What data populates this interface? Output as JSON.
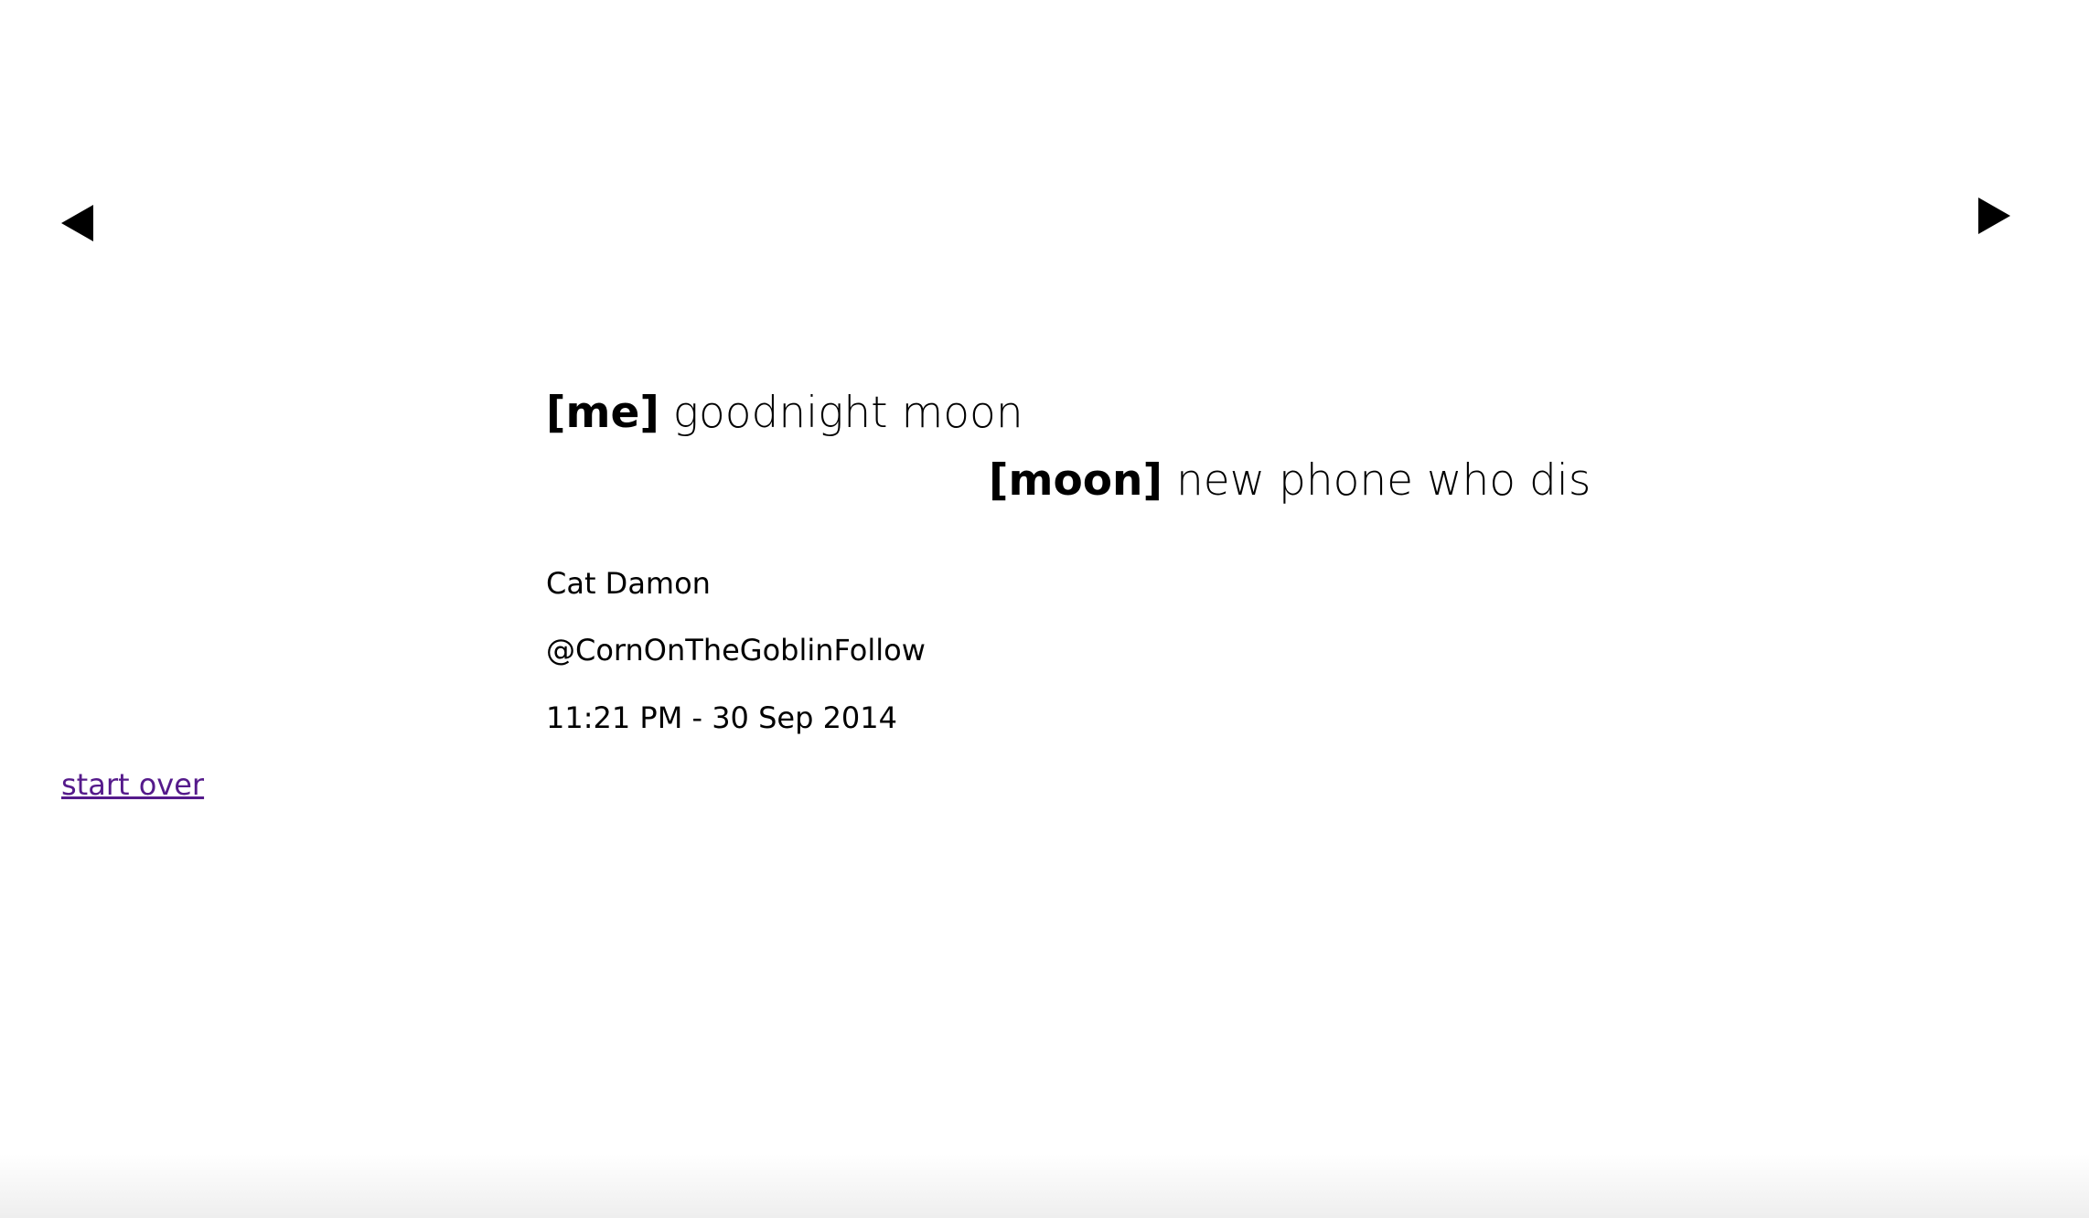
{
  "navigation": {
    "prev_icon": "left-triangle-icon",
    "next_icon": "right-triangle-icon"
  },
  "dialogue": [
    {
      "speaker": "[me]",
      "text": "goodnight moon"
    },
    {
      "speaker": "[moon]",
      "text": "new phone who dis"
    }
  ],
  "tweet": {
    "author_name": "Cat Damon",
    "author_handle": "@CornOnTheGoblinFollow",
    "timestamp": "11:21 PM - 30 Sep 2014"
  },
  "start_over_label": "start over",
  "colors": {
    "link_visited": "#551a8b",
    "text": "#000000",
    "background": "#ffffff"
  }
}
